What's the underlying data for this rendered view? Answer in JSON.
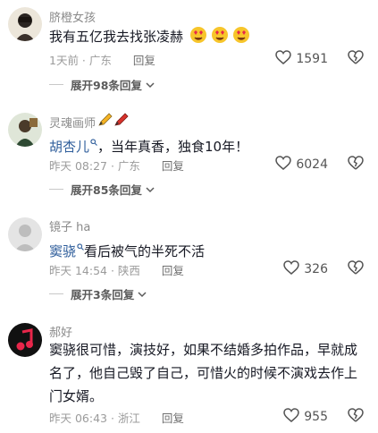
{
  "comments": [
    {
      "username": "脐橙女孩",
      "text": "我有五亿我去找张凌赫",
      "emoji": "heart-eyes-emoji",
      "time": "1天前 · 广东",
      "reply": "回复",
      "likes": "1591",
      "expand": "展开98条回复"
    },
    {
      "username": "灵魂画师",
      "mention": "胡杏儿",
      "text": "，当年真香，独食10年！",
      "time": "昨天 08:27 · 广东",
      "reply": "回复",
      "likes": "6024",
      "expand": "展开85条回复"
    },
    {
      "username": "镜子 ha",
      "mention": "窦骁",
      "text": "看后被气的半死不活",
      "time": "昨天 14:54 · 陕西",
      "reply": "回复",
      "likes": "326",
      "expand": "展开3条回复"
    },
    {
      "username": "郝好",
      "text": "窦骁很可惜，演技好，如果不结婚多拍作品，早就成名了，他自己毁了自己，可惜火的时候不演戏去作上门女婿。",
      "time": "昨天 06:43 · 浙江",
      "reply": "回复",
      "likes": "955"
    }
  ],
  "colors": {
    "username": "#8a8a8a",
    "mention": "#2f5e9b",
    "meta": "#9b9b9b"
  }
}
